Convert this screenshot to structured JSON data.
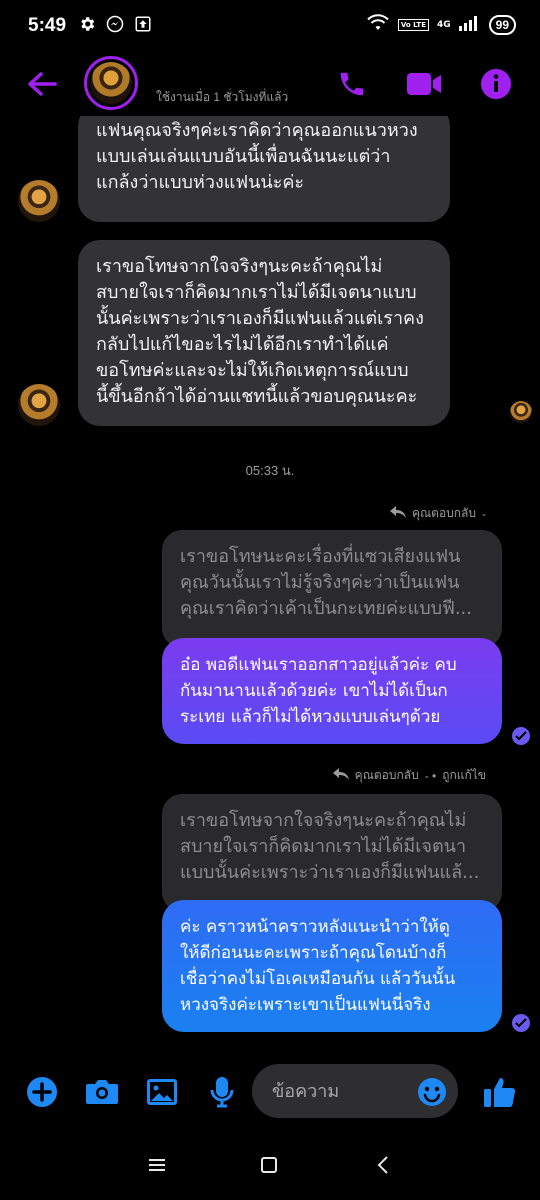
{
  "status_bar": {
    "time": "5:49",
    "battery": "99",
    "network": "4G",
    "volte": "Vo LTE"
  },
  "header": {
    "active_status": "ใช้งานเมื่อ 1 ชั่วโมงที่แล้ว",
    "accent_color": "#a020f0"
  },
  "messages": {
    "incoming_1": [
      "แฟนคุณจริงๆค่ะเราคิดว่าคุณออกแนวหวง",
      "แบบเล่นเล่นแบบอันนี้เพื่อนฉันนะแต่ว่า",
      "แกล้งว่าแบบห่วงแฟนน่ะค่ะ"
    ],
    "incoming_2": [
      "เราขอโทษจากใจจริงๆนะคะถ้าคุณไม่",
      "สบายใจเราก็คิดมากเราไม่ได้มีเจตนาแบบ",
      "นั้นค่ะเพราะว่าเราเองก็มีแฟนแล้วแต่เราคง",
      "กลับไปแก้ไขอะไรไม่ได้อีกเราทำได้แค่",
      "ขอโทษค่ะและจะไม่ให้เกิดเหตุการณ์แบบ",
      "นี้ขึ้นอีกถ้าได้อ่านแชทนี้แล้วขอบคุณนะคะ"
    ],
    "timestamp": "05:33 น.",
    "reply_label_1": "คุณตอบกลับ",
    "quoted_1": [
      "เราขอโทษนะคะเรื่องที่แซวเสียงแฟน",
      "คุณวันนั้นเราไม่รู้จริงๆค่ะว่าเป็นแฟน",
      "คุณเราคิดว่าเค้าเป็นกะเทยค่ะแบบฟี..."
    ],
    "outgoing_1": [
      "อ๋อ พอดีแฟนเราออกสาวอยู่แล้วค่ะ คบ",
      "กันมานานแล้วด้วยค่ะ เขาไม่ได้เป็นก",
      "ระเทย แล้วก็ไม่ได้หวงแบบเล่นๆด้วย"
    ],
    "reply_label_2": "คุณตอบกลับ",
    "edited_label": "ถูกแก้ไข",
    "quoted_2": [
      "เราขอโทษจากใจจริงๆนะคะถ้าคุณไม่",
      "สบายใจเราก็คิดมากเราไม่ได้มีเจตนา",
      "แบบนั้นค่ะเพราะว่าเราเองก็มีแฟนแล้..."
    ],
    "outgoing_2": [
      "ค่ะ คราวหน้าคราวหลังแนะนำว่าให้ดู",
      "ให้ดีก่อนนะคะเพราะถ้าคุณโดนบ้างก็",
      "เชื่อว่าคงไม่โอเคเหมือนกัน แล้ววันนั้น",
      "หวงจริงค่ะเพราะเขาเป็นแฟนนี่จริง"
    ]
  },
  "composer": {
    "placeholder": "ข้อความ",
    "accent_color": "#1e88f5"
  }
}
